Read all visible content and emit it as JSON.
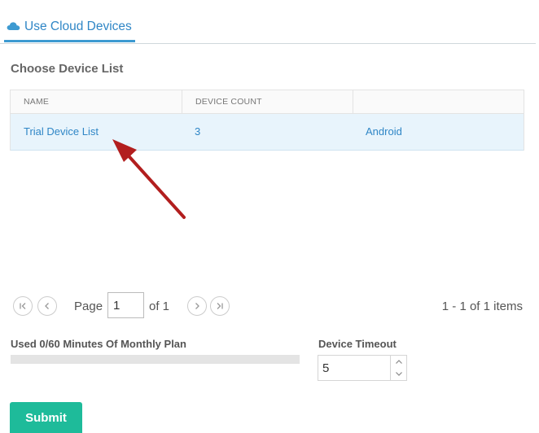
{
  "tab": {
    "label": "Use Cloud Devices",
    "icon": "cloud-icon",
    "accent": "#2f86c6"
  },
  "section": {
    "title": "Choose Device List"
  },
  "grid": {
    "columns": [
      "NAME",
      "DEVICE COUNT",
      ""
    ],
    "rows": [
      {
        "name": "Trial Device List",
        "count": "3",
        "platform": "Android"
      }
    ],
    "selected_row_color": "#e8f4fc"
  },
  "annotation": {
    "icon": "red-arrow-icon",
    "color": "#b21e1e"
  },
  "pager": {
    "page_label": "Page",
    "page_value": "1",
    "of_label": "of 1",
    "items_label": "1 - 1 of 1 items"
  },
  "usage": {
    "label": "Used 0/60 Minutes Of Monthly Plan",
    "fraction": 0
  },
  "timeout": {
    "label": "Device Timeout",
    "value": "5"
  },
  "submit": {
    "label": "Submit",
    "color": "#1ebb9a"
  }
}
